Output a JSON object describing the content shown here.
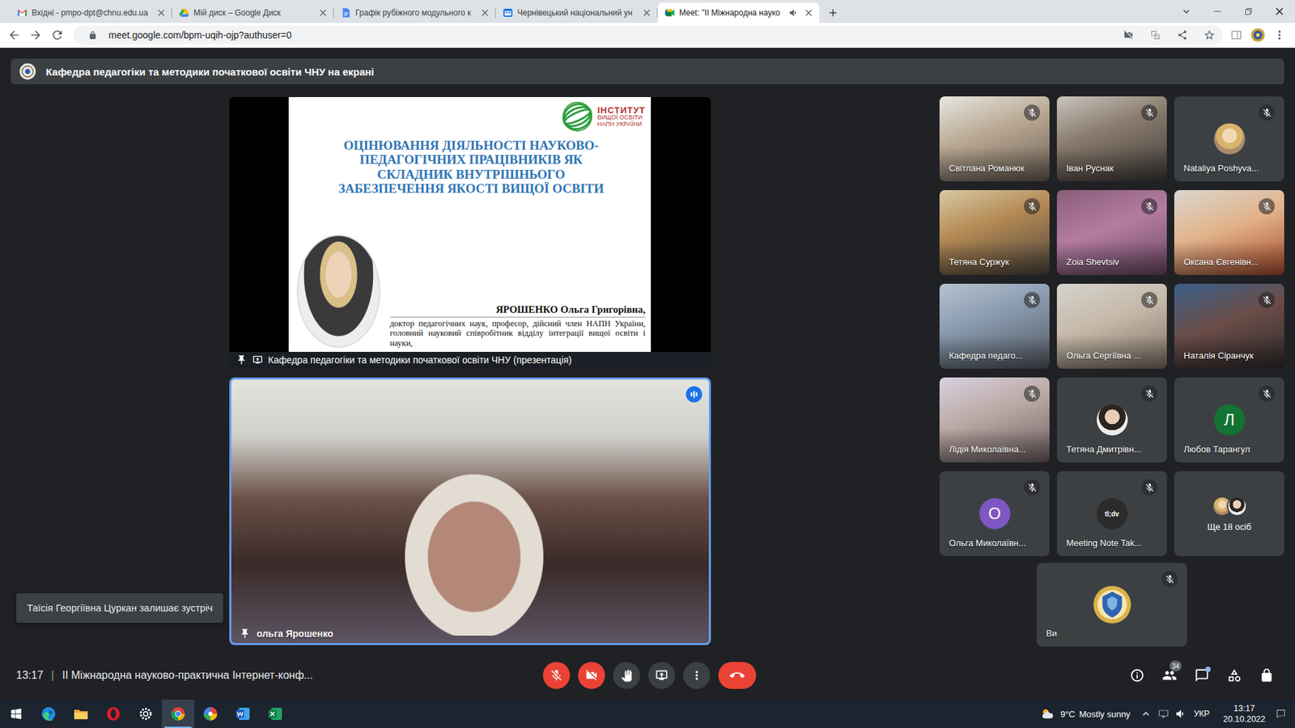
{
  "browser": {
    "tabs": [
      {
        "label": "Вхідні - pmpo-dpt@chnu.edu.ua",
        "selected": false,
        "kind": "gmail",
        "audio": false
      },
      {
        "label": "Мій диск – Google Диск",
        "selected": false,
        "kind": "drive",
        "audio": false
      },
      {
        "label": "Графік рубіжного модульного к",
        "selected": false,
        "kind": "docs",
        "audio": false
      },
      {
        "label": "Чернівецький національний ун",
        "selected": false,
        "kind": "site",
        "audio": false
      },
      {
        "label": "Meet: \"ІІ Міжнародна науко",
        "selected": true,
        "kind": "meet",
        "audio": true
      }
    ],
    "url": "meet.google.com/bpm-uqih-ojp?authuser=0"
  },
  "meet": {
    "presenting_banner": "Кафедра педагогіки та методики початкової освіти ЧНУ на екрані",
    "presentation": {
      "logo_lines": [
        "ІНСТИТУТ",
        "ВИЩОЇ ОСВІТИ",
        "НАПН УКРАЇНИ"
      ],
      "title": [
        "ОЦІНЮВАННЯ ДІЯЛЬНОСТІ НАУКОВО-",
        "ПЕДАГОГІЧНИХ ПРАЦІВНИКІВ ЯК",
        "СКЛАДНИК ВНУТРІШНЬОГО",
        "ЗАБЕЗПЕЧЕННЯ ЯКОСТІ ВИЩОЇ ОСВІТИ"
      ],
      "author": "ЯРОШЕНКО Ольга Григорівна,",
      "author_info": "доктор педагогічних наук, професор, дійсний член НАПН України, головний науковий співробітник відділу інтеграції вищої освіти і науки,",
      "label": "Кафедра педагогіки та методики початкової освіти ЧНУ (презентація)",
      "pinned": true
    },
    "speaker": {
      "name": "ольга Ярошенко",
      "pinned": true,
      "speaking": true
    },
    "participants": [
      {
        "name": "Світлана Романюк",
        "kind": "video",
        "muted": true
      },
      {
        "name": "Іван Руснак",
        "kind": "video",
        "muted": true
      },
      {
        "name": "Nataliya Poshyva...",
        "kind": "photo",
        "muted": true
      },
      {
        "name": "Тетяна Суржук",
        "kind": "video",
        "muted": true
      },
      {
        "name": "Zoia Shevtsiv",
        "kind": "video",
        "muted": true
      },
      {
        "name": "Оксана Євгенівн...",
        "kind": "video",
        "muted": true
      },
      {
        "name": "Кафедра педаго...",
        "kind": "video",
        "muted": true
      },
      {
        "name": "Ольга Сергіївна ...",
        "kind": "video",
        "muted": true
      },
      {
        "name": "Наталія Сіранчук",
        "kind": "video",
        "muted": true
      },
      {
        "name": "Лідія Миколаївна...",
        "kind": "video",
        "muted": true
      },
      {
        "name": "Тетяна Дмитрівн...",
        "kind": "photo",
        "muted": true
      },
      {
        "name": "Любов Тарангул",
        "kind": "letter",
        "letter": "Л",
        "color": "#137333",
        "muted": true
      },
      {
        "name": "Ольга Миколаївн...",
        "kind": "letter",
        "letter": "О",
        "color": "#7e57c2",
        "muted": true
      },
      {
        "name": "Meeting Note Tak...",
        "kind": "logo",
        "avatar_text": "tl;dv",
        "muted": true
      },
      {
        "name": "Ще 18 осіб",
        "kind": "more",
        "muted": false
      }
    ],
    "self": {
      "name": "Ви",
      "muted": true
    },
    "toast": "Таїсія Георгіївна Цуркан залишає зустріч",
    "bottom_bar": {
      "time": "13:17",
      "separator": "|",
      "title": "ІІ Міжнародна науково-практична Інтернет-конф...",
      "mic_on": false,
      "camera_on": false,
      "people_count": "34",
      "chat_unread": true
    }
  },
  "taskbar": {
    "apps": [
      {
        "kind": "start",
        "active": false
      },
      {
        "kind": "edge",
        "active": false
      },
      {
        "kind": "explorer",
        "active": false
      },
      {
        "kind": "opera",
        "active": false
      },
      {
        "kind": "settings",
        "active": false
      },
      {
        "kind": "chrome",
        "active": true
      },
      {
        "kind": "pinwheel",
        "active": false
      },
      {
        "kind": "word",
        "active": false
      },
      {
        "kind": "excel",
        "active": false
      }
    ],
    "weather_temp": "9°C",
    "weather_text": "Mostly sunny",
    "language": "УКР",
    "time": "13:17",
    "date": "20.10.2022"
  }
}
